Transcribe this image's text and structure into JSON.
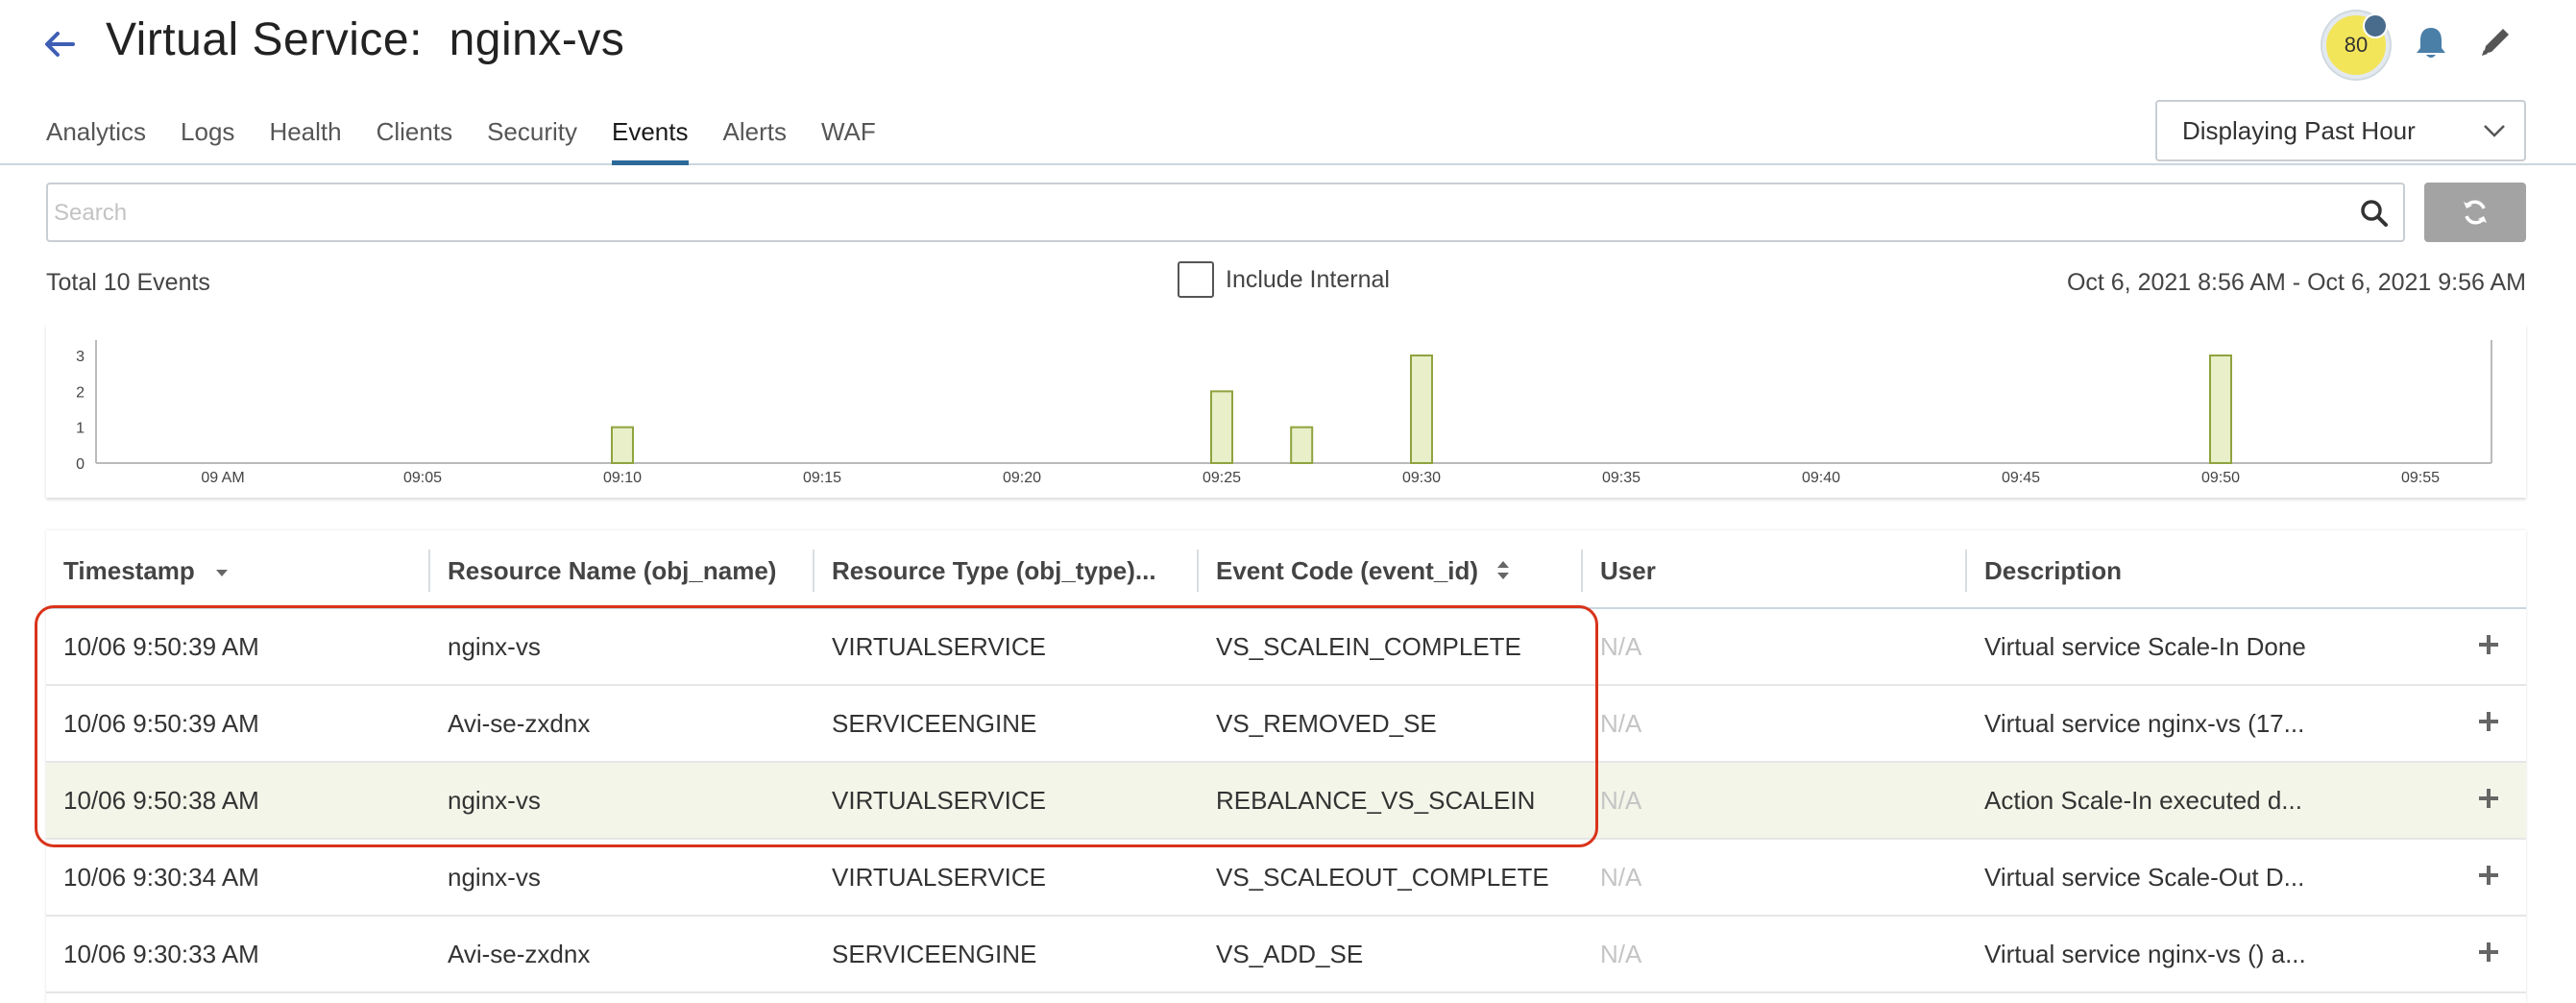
{
  "header": {
    "title": "Virtual Service:  nginx-vs",
    "health_score": "80"
  },
  "tabs": [
    {
      "label": "Analytics"
    },
    {
      "label": "Logs"
    },
    {
      "label": "Health"
    },
    {
      "label": "Clients"
    },
    {
      "label": "Security"
    },
    {
      "label": "Events",
      "active": true
    },
    {
      "label": "Alerts"
    },
    {
      "label": "WAF"
    }
  ],
  "time_range": {
    "selected": "Displaying Past Hour"
  },
  "search": {
    "placeholder": "Search",
    "value": ""
  },
  "summary": {
    "total_events": "Total 10 Events",
    "include_internal_label": "Include Internal",
    "include_internal_checked": false,
    "date_range": "Oct 6, 2021 8:56 AM - Oct 6, 2021 9:56 AM"
  },
  "chart_data": {
    "type": "bar",
    "x_ticks": [
      "09 AM",
      "09:05",
      "09:10",
      "09:15",
      "09:20",
      "09:25",
      "09:30",
      "09:35",
      "09:40",
      "09:45",
      "09:50",
      "09:55"
    ],
    "y_ticks": [
      "0",
      "1",
      "2",
      "3"
    ],
    "ylim": [
      0,
      3
    ],
    "xlim_minutes": [
      0,
      55
    ],
    "points": [
      {
        "x": "09:10",
        "y": 1
      },
      {
        "x": "09:25",
        "y": 2
      },
      {
        "x": "09:27",
        "y": 1
      },
      {
        "x": "09:30",
        "y": 3
      },
      {
        "x": "09:50",
        "y": 3
      }
    ],
    "bar_color": "#e8efc9",
    "bar_stroke": "#8fa33f"
  },
  "table": {
    "columns": [
      {
        "label": "Timestamp",
        "sort": "desc"
      },
      {
        "label": "Resource Name (obj_name)"
      },
      {
        "label": "Resource Type (obj_type)..."
      },
      {
        "label": "Event Code (event_id)",
        "sort": "both"
      },
      {
        "label": "User"
      },
      {
        "label": "Description"
      }
    ],
    "rows": [
      {
        "timestamp": "10/06 9:50:39 AM",
        "name": "nginx-vs",
        "type": "VIRTUALSERVICE",
        "code": "VS_SCALEIN_COMPLETE",
        "user": "N/A",
        "description": "Virtual service Scale-In Done"
      },
      {
        "timestamp": "10/06 9:50:39 AM",
        "name": "Avi-se-zxdnx",
        "type": "SERVICEENGINE",
        "code": "VS_REMOVED_SE",
        "user": "N/A",
        "description": "Virtual service nginx-vs (17..."
      },
      {
        "timestamp": "10/06 9:50:38 AM",
        "name": "nginx-vs",
        "type": "VIRTUALSERVICE",
        "code": "REBALANCE_VS_SCALEIN",
        "user": "N/A",
        "description": "Action Scale-In executed d..."
      },
      {
        "timestamp": "10/06 9:30:34 AM",
        "name": "nginx-vs",
        "type": "VIRTUALSERVICE",
        "code": "VS_SCALEOUT_COMPLETE",
        "user": "N/A",
        "description": "Virtual service Scale-Out D..."
      },
      {
        "timestamp": "10/06 9:30:33 AM",
        "name": "Avi-se-zxdnx",
        "type": "SERVICEENGINE",
        "code": "VS_ADD_SE",
        "user": "N/A",
        "description": "Virtual service nginx-vs () a..."
      }
    ]
  },
  "colors": {
    "accent": "#2c6a99",
    "back_arrow": "#3f5fb5",
    "health_badge": "#f2e55a",
    "callout": "#d9331a",
    "row_highlight": "#f2f5e8"
  }
}
